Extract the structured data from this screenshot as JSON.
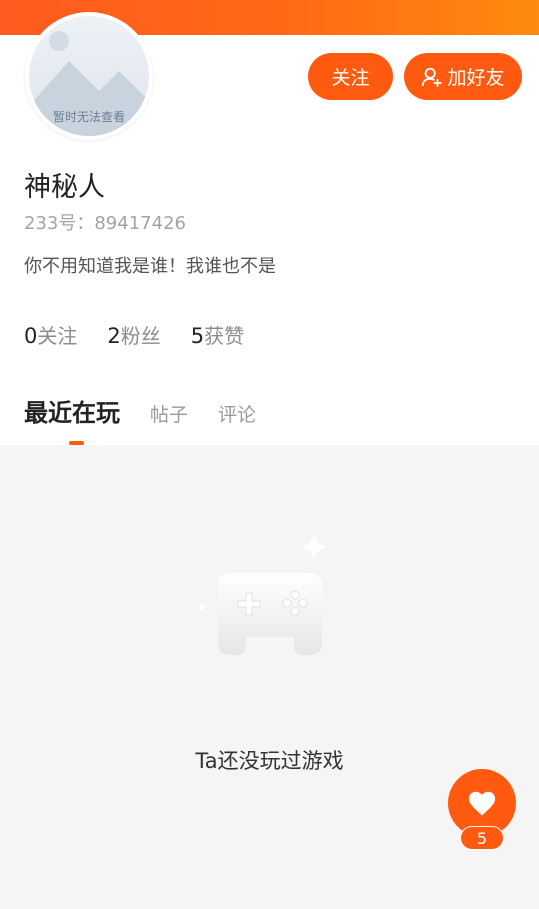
{
  "avatar": {
    "placeholder_text": "暂时无法查看"
  },
  "actions": {
    "follow_label": "关注",
    "add_friend_label": "加好友"
  },
  "profile": {
    "name": "神秘人",
    "id_label": "233号：",
    "id_value": "89417426",
    "bio": "你不用知道我是谁！我谁也不是"
  },
  "stats": [
    {
      "num": "0",
      "label": "关注"
    },
    {
      "num": "2",
      "label": "粉丝"
    },
    {
      "num": "5",
      "label": "获赞"
    }
  ],
  "tabs": [
    {
      "label": "最近在玩",
      "active": true
    },
    {
      "label": "帖子",
      "active": false
    },
    {
      "label": "评论",
      "active": false
    }
  ],
  "empty_state": {
    "message": "Ta还没玩过游戏",
    "icon": "gamepad-icon"
  },
  "like": {
    "count": "5",
    "icon": "heart-icon"
  },
  "colors": {
    "accent": "#ff5a0f",
    "banner_start": "#ff5a1f",
    "banner_end": "#ff8a0e"
  }
}
